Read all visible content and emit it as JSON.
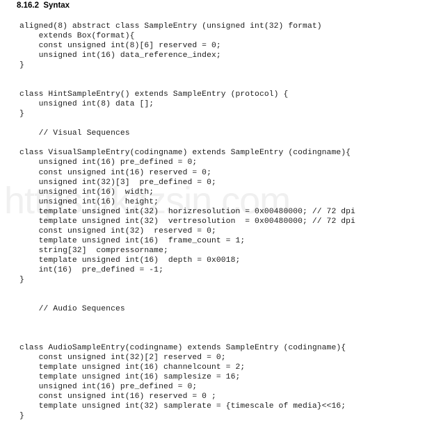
{
  "document": {
    "heading": "8.16.2  Syntax",
    "watermark": "https://kzzsin.com",
    "background_color": "#ffffff",
    "text_color": "#1a1a1a",
    "watermark_color": "#f0f0f0"
  },
  "code_blocks": [
    {
      "id": "sample-entry",
      "text": "aligned(8) abstract class SampleEntry (unsigned int(32) format)\n    extends Box(format){\n    const unsigned int(8)[6] reserved = 0;\n    unsigned int(16) data_reference_index;\n}"
    },
    {
      "id": "hint-sample-entry",
      "text": "class HintSampleEntry() extends SampleEntry (protocol) {\n    unsigned int(8) data [];\n}"
    },
    {
      "id": "visual-sequences-comment",
      "text": "    // Visual Sequences"
    },
    {
      "id": "visual-sample-entry",
      "text": "class VisualSampleEntry(codingname) extends SampleEntry (codingname){\n    unsigned int(16) pre_defined = 0;\n    const unsigned int(16) reserved = 0;\n    unsigned int(32)[3]  pre_defined = 0;\n    unsigned int(16)  width;\n    unsigned int(16)  height;\n    template unsigned int(32)  horizresolution = 0x00480000; // 72 dpi\n    template unsigned int(32)  vertresolution  = 0x00480000; // 72 dpi\n    const unsigned int(32)  reserved = 0;\n    template unsigned int(16)  frame_count = 1;\n    string[32]  compressorname;\n    template unsigned int(16)  depth = 0x0018;\n    int(16)  pre_defined = -1;\n}"
    },
    {
      "id": "audio-sequences-comment",
      "text": "    // Audio Sequences"
    },
    {
      "id": "audio-sample-entry",
      "text": "class AudioSampleEntry(codingname) extends SampleEntry (codingname){\n    const unsigned int(32)[2] reserved = 0;\n    template unsigned int(16) channelcount = 2;\n    template unsigned int(16) samplesize = 16;\n    unsigned int(16) pre_defined = 0;\n    const unsigned int(16) reserved = 0 ;\n    template unsigned int(32) samplerate = {timescale of media}<<16;\n}"
    }
  ]
}
